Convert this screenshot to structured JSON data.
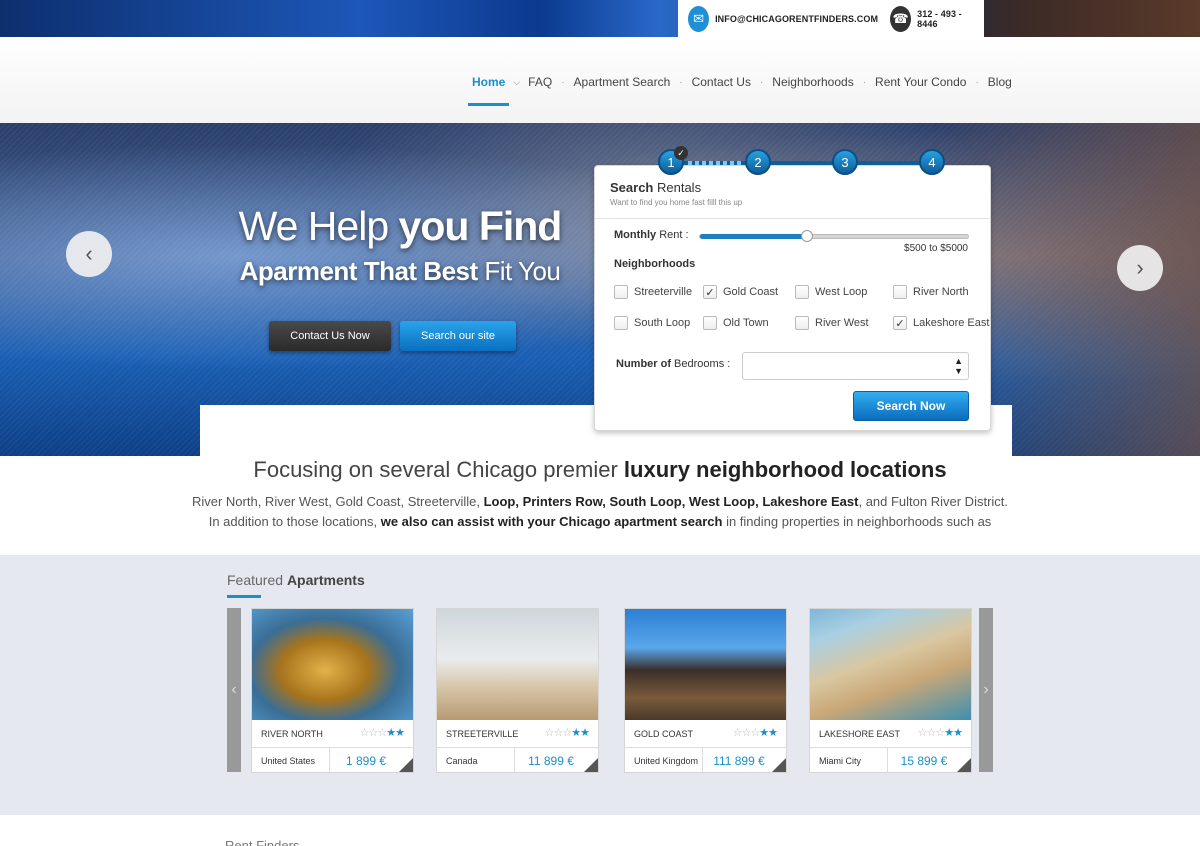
{
  "topbar": {
    "email": "INFO@CHICAGORENTFINDERS.COM",
    "phone": "312 - 493 - 8446",
    "email_icon": "envelope-icon",
    "phone_icon": "telephone-icon"
  },
  "nav": {
    "items": [
      "Home",
      "FAQ",
      "Apartment Search",
      "Contact Us",
      "Neighborhoods",
      "Rent Your Condo",
      "Blog"
    ],
    "separator": "·",
    "active_index": 0,
    "accent_color": "#1b8fc9"
  },
  "hero": {
    "headline_light": "We Help ",
    "headline_bold": "you Find",
    "subline_bold": "Aparment That Best ",
    "subline_light": "Fit You",
    "btn_contact": "Contact Us Now",
    "btn_search": "Search our site",
    "prev_icon": "chevron-left-icon",
    "next_icon": "chevron-right-icon"
  },
  "search": {
    "steps": [
      "1",
      "2",
      "3",
      "4"
    ],
    "completed_step_icon": "check-icon",
    "title_bold": "Search",
    "title_light": " Rentals",
    "subtitle": "Want to find you home fast filll this up",
    "rent_label_bold": "Monthly",
    "rent_label_light": " Rent :",
    "rent_level": 0.4,
    "rent_range": "$500 to $5000",
    "neighborhoods_label": "Neighborhoods",
    "neighborhoods": [
      {
        "label": "Streeterville",
        "checked": false
      },
      {
        "label": "Gold Coast",
        "checked": true
      },
      {
        "label": "West Loop",
        "checked": false
      },
      {
        "label": "River North",
        "checked": false
      },
      {
        "label": "South Loop",
        "checked": false
      },
      {
        "label": "Old Town",
        "checked": false
      },
      {
        "label": "River West",
        "checked": false
      },
      {
        "label": "Lakeshore East",
        "checked": true
      }
    ],
    "bedrooms_label_bold": "Number of",
    "bedrooms_label_light": " Bedrooms :",
    "bedrooms_value": "",
    "submit": "Search Now"
  },
  "intro": {
    "heading_light": "Focusing on several Chicago premier ",
    "heading_bold": "luxury neighborhood locations",
    "line1_a": "River North, River West, Gold Coast, Streeterville, ",
    "line1_b": "Loop, Printers Row, South Loop, West Loop, Lakeshore East",
    "line1_c": ", and Fulton River District.",
    "line2_a": "In addition to those locations, ",
    "line2_b": "we also can assist with your Chicago apartment search",
    "line2_c": " in finding properties in neighborhoods such as"
  },
  "featured": {
    "title_light": "Featured ",
    "title_bold": "Apartments",
    "cards": [
      {
        "neighborhood": "RIVER NORTH",
        "country": "United States",
        "price": "1 899 €",
        "stars": 2
      },
      {
        "neighborhood": "STREETERVILLE",
        "country": "Canada",
        "price": "11 899 €",
        "stars": 2
      },
      {
        "neighborhood": "GOLD COAST",
        "country": "United Kingdom",
        "price": "111 899 €",
        "stars": 2
      },
      {
        "neighborhood": "LAKESHORE EAST",
        "country": "Miami City",
        "price": "15 899 €",
        "stars": 2
      }
    ]
  },
  "bottom": {
    "partial_heading": "Rent Finders"
  }
}
